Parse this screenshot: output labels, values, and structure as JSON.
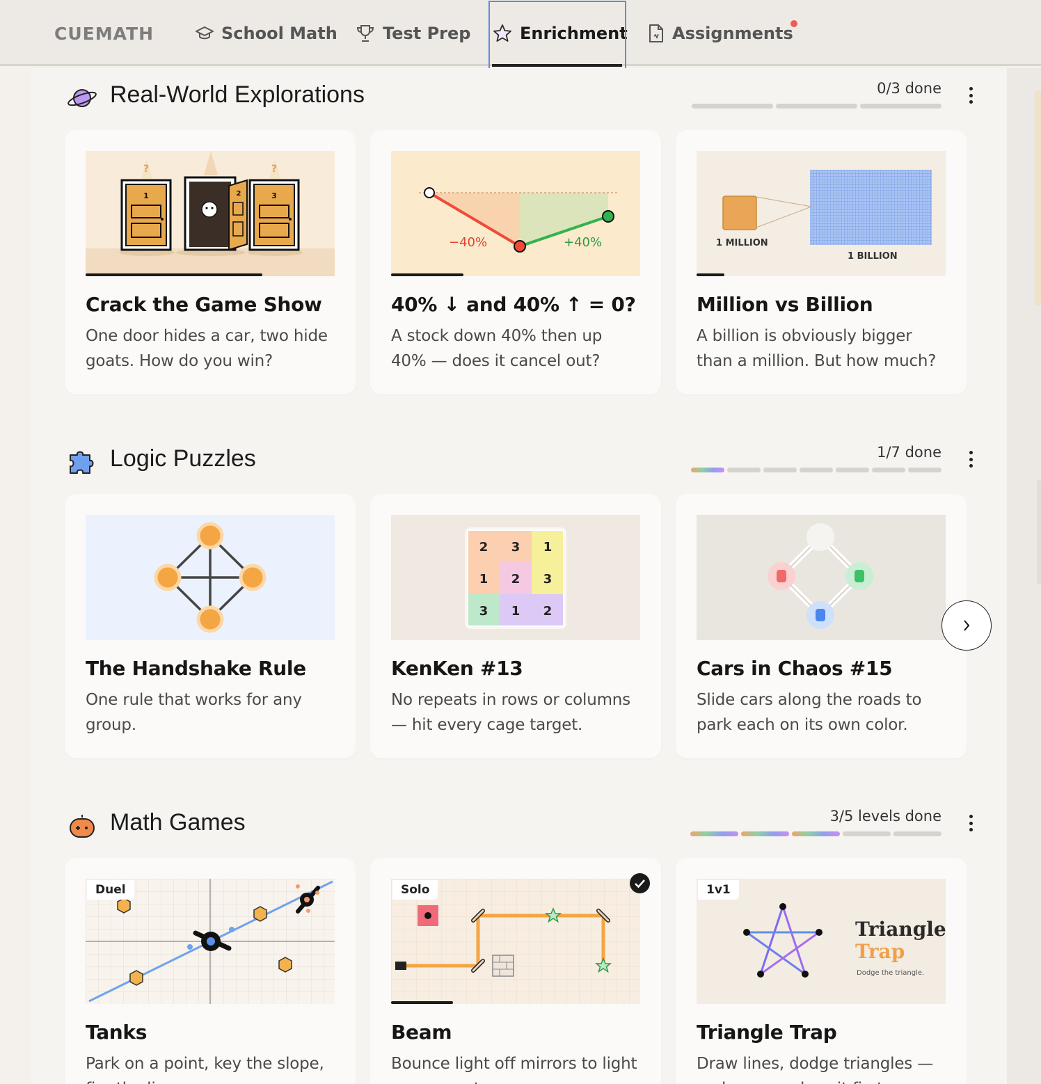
{
  "brand": "CUEMATH",
  "nav": {
    "tabs": [
      {
        "label": "School Math",
        "icon": "graduation-cap-icon"
      },
      {
        "label": "Test Prep",
        "icon": "trophy-icon"
      },
      {
        "label": "Enrichment",
        "icon": "star-icon",
        "active": true
      },
      {
        "label": "Assignments",
        "icon": "document-icon",
        "notification": true
      }
    ]
  },
  "sections": [
    {
      "title": "Real-World Explorations",
      "icon": "planet-icon",
      "progress_text": "0/3 done",
      "progress": {
        "done": 0,
        "total": 3
      },
      "cards": [
        {
          "title": "Crack the Game Show",
          "desc": "One door hides a car, two hide goats. How do you win?",
          "progress": 0.71
        },
        {
          "title": "40% ↓ and 40% ↑ = 0?",
          "desc": "A stock down 40% then up 40% — does it cancel out?",
          "progress": 0.29,
          "thumb_labels": [
            "−40%",
            "+40%"
          ]
        },
        {
          "title": "Million vs Billion",
          "desc": "A billion is obviously bigger than a million. But how much?",
          "progress": 0.11,
          "thumb_labels": [
            "1 MILLION",
            "1 BILLION"
          ]
        }
      ]
    },
    {
      "title": "Logic Puzzles",
      "icon": "puzzle-icon",
      "progress_text": "1/7 done",
      "progress": {
        "done": 1,
        "total": 7
      },
      "cards": [
        {
          "title": "The Handshake Rule",
          "desc": "One rule that works for any group."
        },
        {
          "title": "KenKen #13",
          "desc": "No repeats in rows or columns — hit every cage target.",
          "grid": [
            "2",
            "3",
            "1",
            "1",
            "2",
            "3",
            "3",
            "1",
            "2"
          ]
        },
        {
          "title": "Cars in Chaos #15",
          "desc": "Slide cars along the roads to park each on its own color."
        }
      ]
    },
    {
      "title": "Math Games",
      "icon": "gamepad-icon",
      "progress_text": "3/5 levels done",
      "progress": {
        "done": 3,
        "total": 5
      },
      "cards": [
        {
          "title": "Tanks",
          "desc": "Park on a point, key the slope, fire the line.",
          "badge": "Duel"
        },
        {
          "title": "Beam",
          "desc": "Bounce light off mirrors to light up every star.",
          "badge": "Solo",
          "completed": true,
          "progress": 0.25
        },
        {
          "title": "Triangle Trap",
          "desc": "Draw lines, dodge triangles — make one or lose it first.",
          "badge": "1v1",
          "thumb_title_1": "Triangle",
          "thumb_title_2": "Trap",
          "thumb_sub": "Dodge the triangle."
        }
      ]
    }
  ],
  "colors": {
    "accent_blue": "#5b8de0",
    "notification": "#ef5b5b",
    "background": "#f4f1ec"
  }
}
